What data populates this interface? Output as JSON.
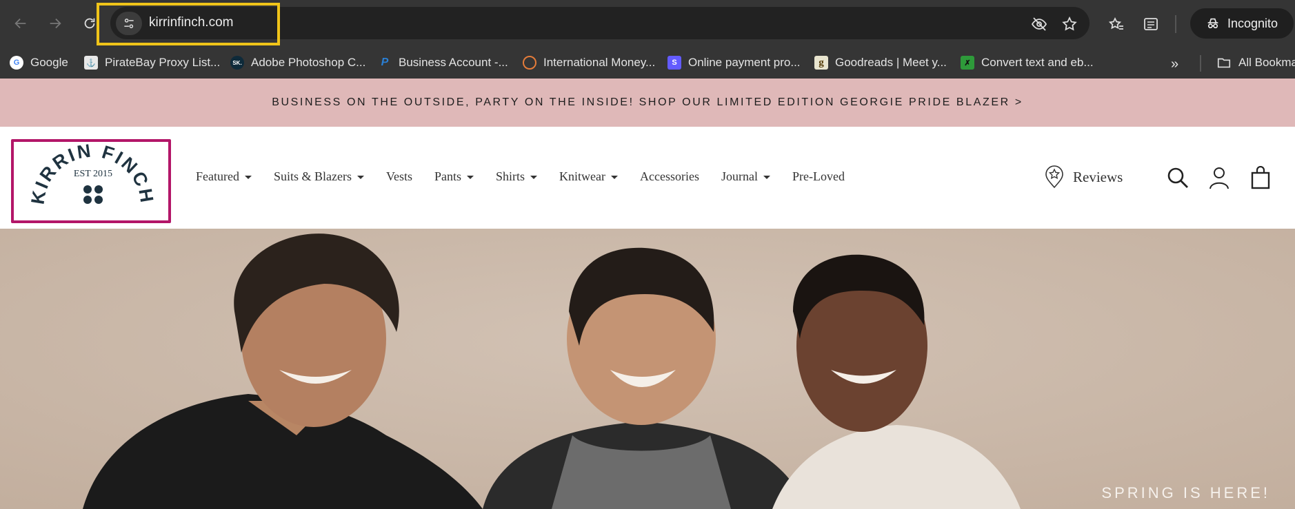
{
  "browser": {
    "url": "kirrinfinch.com",
    "incognito_label": "Incognito",
    "bookmarks": [
      {
        "label": "Google"
      },
      {
        "label": "PirateBay Proxy List..."
      },
      {
        "label": "Adobe Photoshop C...",
        "favicon_text": "SK."
      },
      {
        "label": "Business Account -..."
      },
      {
        "label": "International Money..."
      },
      {
        "label": "Online payment pro...",
        "favicon_text": "S"
      },
      {
        "label": "Goodreads | Meet y...",
        "favicon_text": "g"
      },
      {
        "label": "Convert text and eb..."
      }
    ],
    "all_bookmarks": "All Bookma"
  },
  "announcement": "BUSINESS ON THE OUTSIDE, PARTY ON THE INSIDE! SHOP OUR LIMITED EDITION GEORGIE PRIDE BLAZER >",
  "logo": {
    "name": "KIRRIN FINCH",
    "est": "EST 2015"
  },
  "nav": [
    {
      "label": "Featured",
      "dropdown": true
    },
    {
      "label": "Suits & Blazers",
      "dropdown": true
    },
    {
      "label": "Vests",
      "dropdown": false
    },
    {
      "label": "Pants",
      "dropdown": true
    },
    {
      "label": "Shirts",
      "dropdown": true
    },
    {
      "label": "Knitwear",
      "dropdown": true
    },
    {
      "label": "Accessories",
      "dropdown": false
    },
    {
      "label": "Journal",
      "dropdown": true
    },
    {
      "label": "Pre-Loved",
      "dropdown": false
    }
  ],
  "reviews_label": "Reviews",
  "hero": {
    "text": "SPRING IS HERE!"
  },
  "colors": {
    "announcement_bg": "#dfb8b8",
    "logo_border": "#b31668",
    "logo_ink": "#1f3340",
    "highlight": "#f0c419"
  }
}
